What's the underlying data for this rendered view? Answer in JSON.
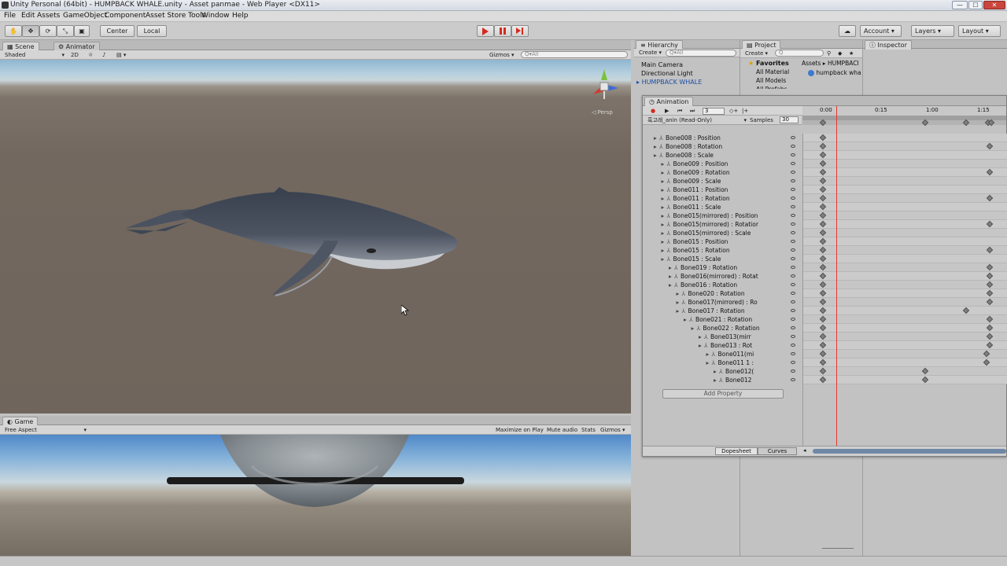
{
  "window": {
    "title": "Unity Personal (64bit) - HUMPBACK WHALE.unity - Asset panmae - Web Player <DX11>",
    "controls": [
      "—",
      "☐",
      "✕"
    ]
  },
  "menu": [
    "File",
    "Edit",
    "Assets",
    "GameObject",
    "Component",
    "Asset Store Tools",
    "Window",
    "Help"
  ],
  "toolbar": {
    "pivot": "Center",
    "space": "Local",
    "account": "Account",
    "layers": "Layers",
    "layout": "Layout"
  },
  "scene": {
    "tabs": [
      "Scene",
      "Animator"
    ],
    "shading": "Shaded",
    "mode2d": "2D",
    "gizmos": "Gizmos",
    "search_placeholder": "Q▾All",
    "persp": "◁ Persp"
  },
  "game": {
    "tab": "Game",
    "aspect": "Free Aspect",
    "buttons": [
      "Maximize on Play",
      "Mute audio",
      "Stats",
      "Gizmos"
    ]
  },
  "hierarchy": {
    "tab": "Hierarchy",
    "create": "Create",
    "search_placeholder": "Q▾All",
    "items": [
      "Main Camera",
      "Directional Light",
      "HUMPBACK WHALE"
    ]
  },
  "project": {
    "tab": "Project",
    "create": "Create",
    "favorites": "Favorites",
    "fav_items": [
      "All Material",
      "All Models",
      "All Prefabs"
    ],
    "breadcrumb": "Assets ▸ HUMPBACI",
    "asset": "humpback wha"
  },
  "inspector": {
    "tab": "Inspector"
  },
  "animation": {
    "tab": "Animation",
    "frame": "3",
    "clip": "흑고래_anin (Read-Only)",
    "samples_label": "Samples",
    "samples": "30",
    "time_labels": [
      "0:00",
      "0:15",
      "1:00",
      "1:15"
    ],
    "add_property": "Add Property",
    "dopesheet": "Dopesheet",
    "curves": "Curves",
    "properties": [
      {
        "label": "Bone008 : Position",
        "indent": 0
      },
      {
        "label": "Bone008 : Rotation",
        "indent": 0
      },
      {
        "label": "Bone008 : Scale",
        "indent": 0
      },
      {
        "label": "Bone009 : Position",
        "indent": 1
      },
      {
        "label": "Bone009 : Rotation",
        "indent": 1
      },
      {
        "label": "Bone009 : Scale",
        "indent": 1
      },
      {
        "label": "Bone011 : Position",
        "indent": 1
      },
      {
        "label": "Bone011 : Rotation",
        "indent": 1
      },
      {
        "label": "Bone011 : Scale",
        "indent": 1
      },
      {
        "label": "Bone015(mirrored) : Position",
        "indent": 1
      },
      {
        "label": "Bone015(mirrored) : Rotatior",
        "indent": 1
      },
      {
        "label": "Bone015(mirrored) : Scale",
        "indent": 1
      },
      {
        "label": "Bone015 : Position",
        "indent": 1
      },
      {
        "label": "Bone015 : Rotation",
        "indent": 1
      },
      {
        "label": "Bone015 : Scale",
        "indent": 1
      },
      {
        "label": "Bone019 : Rotation",
        "indent": 2
      },
      {
        "label": "Bone016(mirrored) : Rotat",
        "indent": 2
      },
      {
        "label": "Bone016 : Rotation",
        "indent": 2
      },
      {
        "label": "Bone020 : Rotation",
        "indent": 3
      },
      {
        "label": "Bone017(mirrored) : Ro",
        "indent": 3
      },
      {
        "label": "Bone017 : Rotation",
        "indent": 3
      },
      {
        "label": "Bone021 : Rotation",
        "indent": 4
      },
      {
        "label": "Bone022 : Rotation",
        "indent": 5
      },
      {
        "label": "Bone013(mirr",
        "indent": 6
      },
      {
        "label": "Bone013 : Rot",
        "indent": 6
      },
      {
        "label": "Bone011(mi",
        "indent": 7
      },
      {
        "label": "Bone011 1 :",
        "indent": 7
      },
      {
        "label": "Bone012(",
        "indent": 8
      },
      {
        "label": "Bone012",
        "indent": 8
      }
    ]
  }
}
